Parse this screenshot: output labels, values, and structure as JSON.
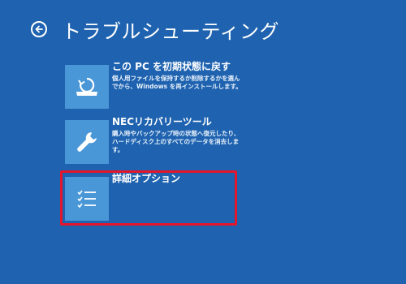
{
  "header": {
    "back_icon": "back-arrow-icon",
    "title": "トラブルシューティング"
  },
  "options": [
    {
      "icon": "reset-pc-icon",
      "label": "この PC を初期状態に戻す",
      "description": "個人用ファイルを保持するか削除するかを選んでから、Windows を再インストールします。"
    },
    {
      "icon": "wrench-icon",
      "label": "NECリカバリーツール",
      "description": "購入時やバックアップ時の状態へ復元したり、ハードディスク上のすべてのデータを消去します。"
    },
    {
      "icon": "checklist-icon",
      "label": "詳細オプション",
      "description": ""
    }
  ],
  "colors": {
    "background": "#1f63b0",
    "tile": "#4a97d8",
    "highlight": "#e3162b",
    "text": "#ffffff"
  }
}
